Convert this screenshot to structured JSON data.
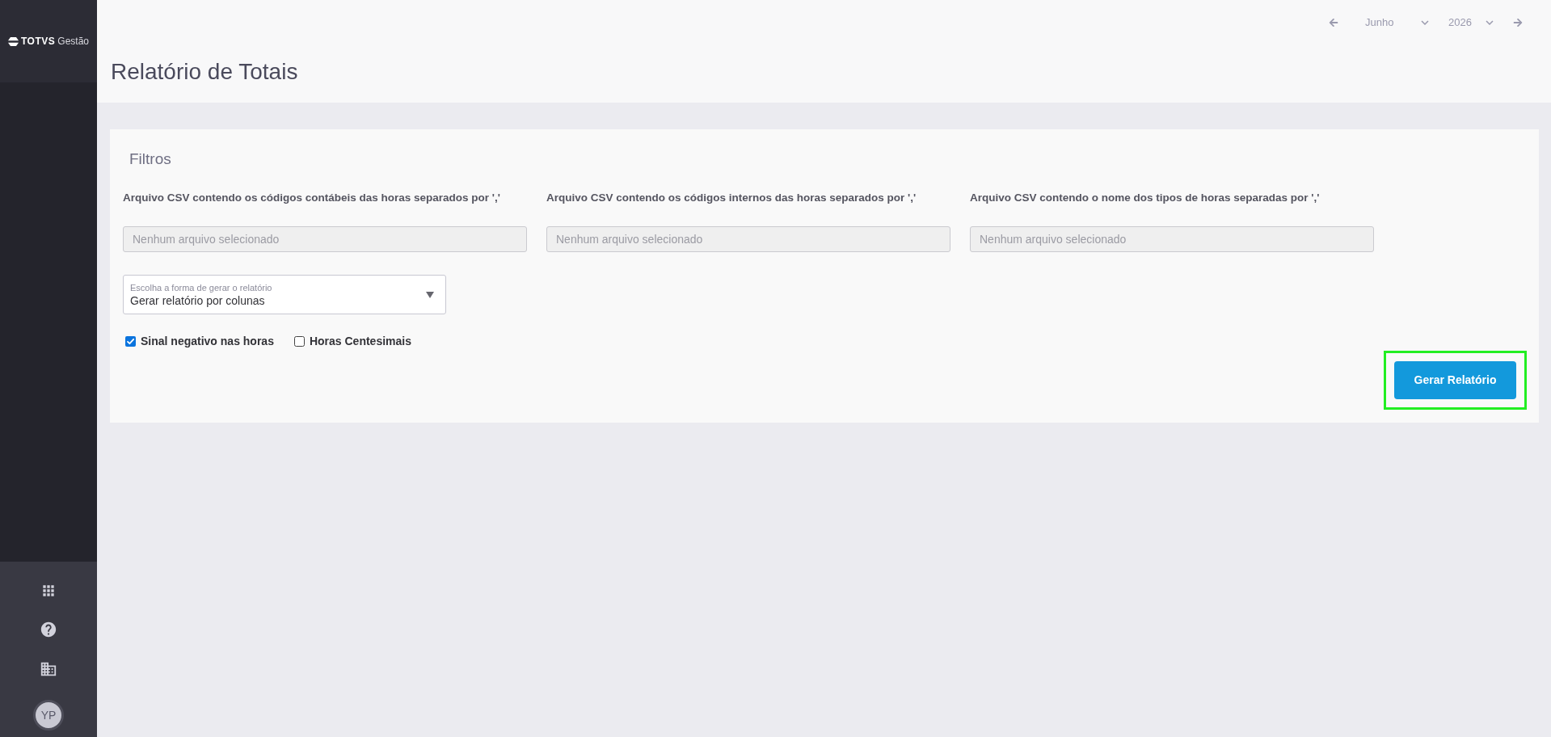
{
  "sidebar": {
    "logo": {
      "brand": "TOTVS",
      "product": "Gestão"
    },
    "user_initials": "YP"
  },
  "header": {
    "title": "Relatório de Totais",
    "period": {
      "month": "Junho",
      "year": "2026"
    }
  },
  "filters": {
    "title": "Filtros",
    "file_fields": [
      {
        "label": "Arquivo CSV contendo os códigos contábeis das horas separados por ','",
        "placeholder": "Nenhum arquivo selecionado"
      },
      {
        "label": "Arquivo CSV contendo os códigos internos das horas separados por ','",
        "placeholder": "Nenhum arquivo selecionado"
      },
      {
        "label": "Arquivo CSV contendo o nome dos tipos de horas separadas por ','",
        "placeholder": "Nenhum arquivo selecionado"
      }
    ],
    "select": {
      "label": "Escolha a forma de gerar o relatório",
      "value": "Gerar relatório por colunas"
    },
    "checkboxes": [
      {
        "label": "Sinal negativo nas horas",
        "checked": true
      },
      {
        "label": "Horas Centesimais",
        "checked": false
      }
    ],
    "submit": {
      "label": "Gerar Relatório",
      "highlighted": true
    }
  }
}
